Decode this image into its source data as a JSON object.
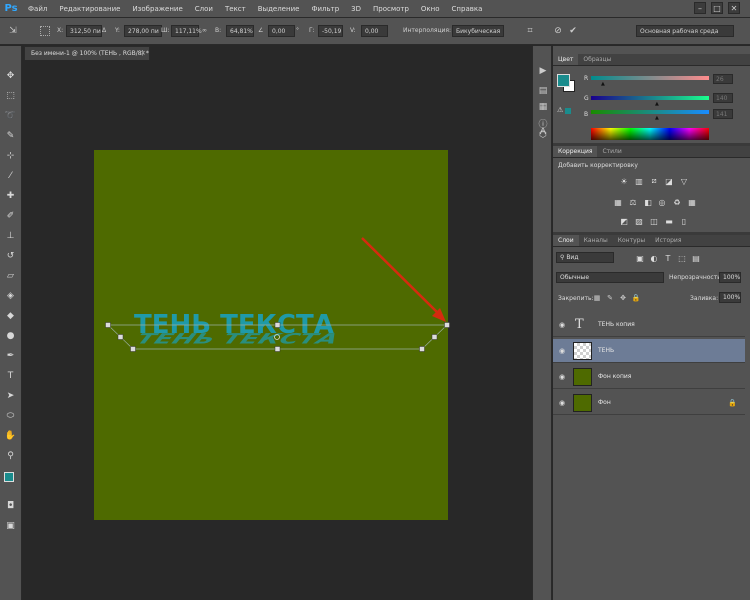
{
  "app": {
    "logo": "Ps"
  },
  "menu": [
    "Файл",
    "Редактирование",
    "Изображение",
    "Слои",
    "Текст",
    "Выделение",
    "Фильтр",
    "3D",
    "Просмотр",
    "Окно",
    "Справка"
  ],
  "options": {
    "x_label": "X:",
    "x_value": "312,50 пи",
    "y_label": "Y:",
    "y_value": "278,00 пи",
    "w_label": "Ш:",
    "w_value": "117,11%",
    "h_label": "В:",
    "h_value": "64,81%",
    "angle_value": "0,00",
    "angle_unit": "°",
    "hskew_label": "Г:",
    "hskew_value": "-50,19",
    "vskew_label": "V:",
    "vskew_value": "0,00",
    "interp_label": "Интерполяция:",
    "interp_value": "Бикубическая",
    "workspace": "Основная рабочая среда"
  },
  "document": {
    "tab_title": "Без имени-1 @ 100% (ТЕНЬ , RGB/8) *",
    "text": "ТЕНЬ ТЕКСТА",
    "canvas_color": "#4e6a00",
    "text_color": "#1f9aa8"
  },
  "color_panel": {
    "tabs": [
      "Цвет",
      "Образцы"
    ],
    "r_label": "R",
    "r_value": "26",
    "g_label": "G",
    "g_value": "140",
    "b_label": "B",
    "b_value": "141",
    "fg_color": "#1a8c8d"
  },
  "adjust_panel": {
    "tabs": [
      "Коррекция",
      "Стили"
    ],
    "title": "Добавить корректировку"
  },
  "layers_panel": {
    "tabs": [
      "Слои",
      "Каналы",
      "Контуры",
      "История"
    ],
    "search_placeholder": "Вид",
    "blend_mode": "Обычные",
    "opacity_label": "Непрозрачность:",
    "opacity_value": "100%",
    "lock_label": "Закрепить:",
    "fill_label": "Заливка:",
    "fill_value": "100%",
    "layers": [
      {
        "name": "ТЕНЬ копия",
        "type": "text",
        "selected": false
      },
      {
        "name": "ТЕНЬ",
        "type": "transparent",
        "selected": true
      },
      {
        "name": "Фон копия",
        "type": "fill",
        "selected": false
      },
      {
        "name": "Фон",
        "type": "fill",
        "selected": false,
        "locked": true
      }
    ]
  }
}
